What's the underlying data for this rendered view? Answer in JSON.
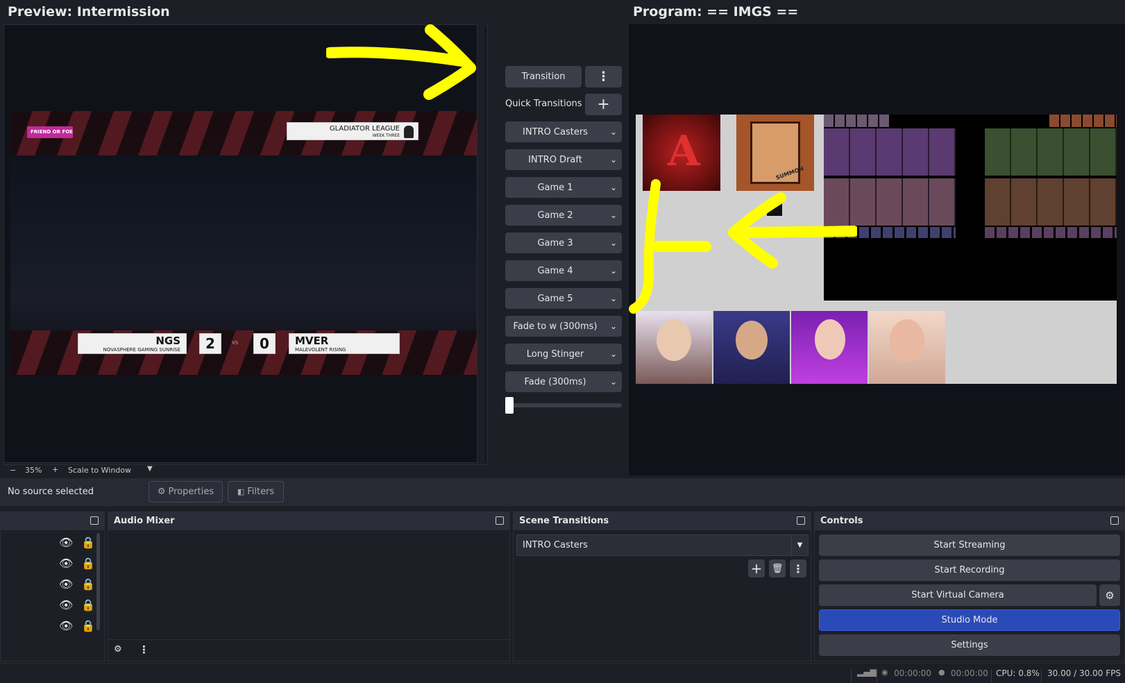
{
  "preview": {
    "title": "Preview: Intermission"
  },
  "program": {
    "title": "Program: == IMGS =="
  },
  "overlay": {
    "sponsor": "FRIEND OR FOE",
    "league_title": "GLADIATOR LEAGUE",
    "league_sub": "WEEK THREE",
    "team_left_code": "NGS",
    "team_left_name": "NOVASPHERE GAMING SUNRISE",
    "score_left": "2",
    "vs": "VS",
    "score_right": "0",
    "team_right_code": "MVER",
    "team_right_name": "MALEVOLENT RISING",
    "brand_text": "SUMMON"
  },
  "transition_panel": {
    "transition_label": "Transition",
    "quick_transitions_label": "Quick Transitions",
    "items": [
      {
        "label": "INTRO Casters"
      },
      {
        "label": "INTRO Draft"
      },
      {
        "label": "Game 1"
      },
      {
        "label": "Game 2"
      },
      {
        "label": "Game 3"
      },
      {
        "label": "Game 4"
      },
      {
        "label": "Game 5"
      },
      {
        "label": "Fade to w (300ms)"
      },
      {
        "label": "Long Stinger"
      },
      {
        "label": "Fade (300ms)"
      }
    ]
  },
  "zoom_bar": {
    "minus": "−",
    "zoom": "35%",
    "plus": "+",
    "scale": "Scale to Window"
  },
  "source_bar": {
    "status": "No source selected",
    "properties": "Properties",
    "filters": "Filters"
  },
  "docks": {
    "audio_mixer": "Audio Mixer",
    "scene_transitions": "Scene Transitions",
    "controls": "Controls"
  },
  "scene_transitions": {
    "selected": "INTRO Casters"
  },
  "controls": {
    "start_streaming": "Start Streaming",
    "start_recording": "Start Recording",
    "start_virtual_camera": "Start Virtual Camera",
    "studio_mode": "Studio Mode",
    "settings": "Settings"
  },
  "status": {
    "stream_time": "00:00:00",
    "record_time": "00:00:00",
    "cpu": "CPU: 0.8%",
    "fps": "30.00 / 30.00 FPS"
  },
  "colors": {
    "accent": "#2a4ab8",
    "annotation": "#ffff00",
    "panel": "#1d1f26",
    "button": "#3b3e49"
  }
}
